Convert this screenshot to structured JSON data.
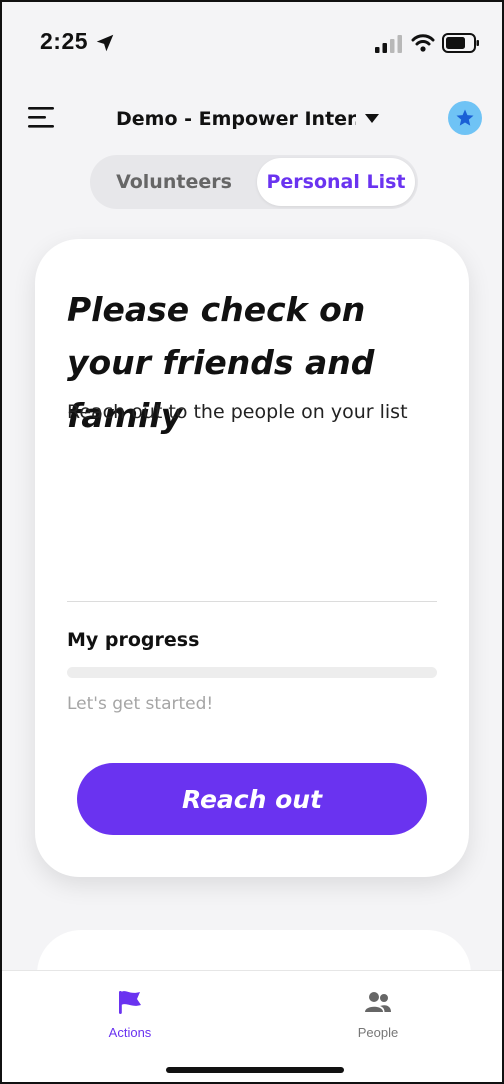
{
  "status_bar": {
    "time": "2:25",
    "icons": [
      "location-arrow-icon",
      "signal-icon",
      "wifi-icon",
      "battery-icon"
    ]
  },
  "header": {
    "org_name": "Demo - Empower Inter...",
    "menu_icon": "hamburger-menu-icon",
    "caret_icon": "caret-down-icon",
    "badge_icon": "star-icon"
  },
  "segment": {
    "tabs": [
      {
        "label": "Volunteers",
        "selected": false
      },
      {
        "label": "Personal List",
        "selected": true
      }
    ]
  },
  "card": {
    "title": "Please check on your friends and family",
    "subtitle": "Reach out to the people on your list",
    "progress_label": "My progress",
    "progress_value": 0,
    "progress_note": "Let's get started!",
    "button_label": "Reach out"
  },
  "tab_bar": {
    "items": [
      {
        "label": "Actions",
        "icon": "flag-icon",
        "active": true
      },
      {
        "label": "People",
        "icon": "people-icon",
        "active": false
      }
    ]
  },
  "colors": {
    "accent": "#6a33f0",
    "background": "#f4f4f6",
    "badge": "#6fc3f5"
  }
}
